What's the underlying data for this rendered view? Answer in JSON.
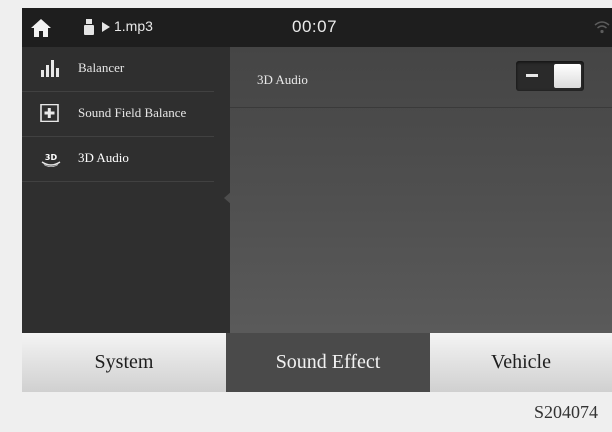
{
  "status_bar": {
    "track": "1.mp3",
    "time": "00:07",
    "icons": [
      "home-icon",
      "usb-icon",
      "play-icon",
      "wifi-icon"
    ]
  },
  "sidebar": {
    "items": [
      {
        "label": "Balancer",
        "icon": "equalizer-bars-icon",
        "active": false
      },
      {
        "label": "Sound Field Balance",
        "icon": "sound-field-icon",
        "active": false
      },
      {
        "label": "3D Audio",
        "icon": "3d-audio-icon",
        "icon_text": "3D",
        "active": true
      }
    ]
  },
  "main": {
    "setting_label": "3D Audio",
    "toggle_state": "on"
  },
  "bottom_tabs": [
    {
      "label": "System",
      "active": false
    },
    {
      "label": "Sound Effect",
      "active": true
    },
    {
      "label": "Vehicle",
      "active": false
    }
  ],
  "caption": "S204074",
  "colors": {
    "status_bar_bg": "#1e1e1e",
    "sidebar_bg": "#2f2f2f",
    "active_tab_bg": "#4a4a4a",
    "inactive_tab_bg": "#e4e4e4"
  }
}
